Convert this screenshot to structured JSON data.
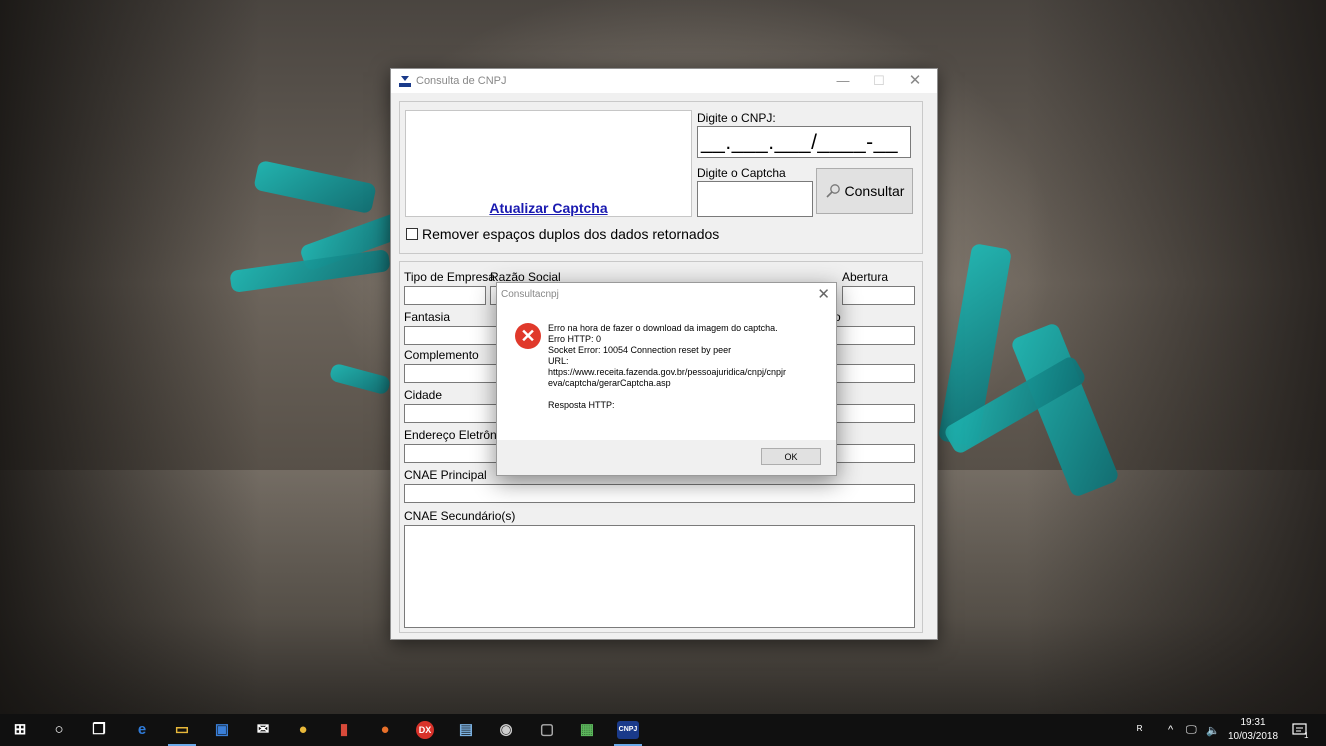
{
  "main_window": {
    "title": "Consulta de CNPJ",
    "minimize_glyph": "—",
    "maximize_glyph": "☐",
    "close_glyph": "✕",
    "captcha_link": "Atualizar Captcha",
    "cnpj_label": "Digite o CNPJ:",
    "cnpj_value": "__.___.___/____-__",
    "captcha_label": "Digite o Captcha",
    "consultar_button": "Consultar",
    "remove_spaces_checkbox": "Remover espaços duplos dos dados retornados",
    "remove_spaces_checked": false,
    "fields": {
      "tipo_empresa": "Tipo de Empresa",
      "razao_social": "Razão Social",
      "abertura": "Abertura",
      "fantasia": "Fantasia",
      "fantasia_right": "o",
      "complemento": "Complemento",
      "cidade": "Cidade",
      "email": "Endereço Eletrônic",
      "cnae_principal": "CNAE Principal",
      "cnae_secundarios": "CNAE Secundário(s)"
    }
  },
  "dialog": {
    "title": "Consultacnpj",
    "close_glyph": "✕",
    "error_glyph": "✕",
    "lines": [
      "Erro na hora de fazer o download da imagem do captcha.",
      "Erro HTTP: 0",
      "Socket Error: 10054 Connection reset by peer",
      "URL:",
      "https://www.receita.fazenda.gov.br/pessoajuridica/cnpj/cnpjr",
      "eva/captcha/gerarCaptcha.asp",
      "",
      "Resposta HTTP:"
    ],
    "ok_button": "OK"
  },
  "taskbar": {
    "apps": [
      {
        "name": "start",
        "glyph": "⊞",
        "color": "#ffffff"
      },
      {
        "name": "search",
        "glyph": "○",
        "color": "#ffffff"
      },
      {
        "name": "task-view",
        "glyph": "❐",
        "color": "#ffffff"
      },
      {
        "name": "edge",
        "glyph": "e",
        "color": "#2f7bd8"
      },
      {
        "name": "file-explorer",
        "glyph": "▭",
        "color": "#e8b83a"
      },
      {
        "name": "store",
        "glyph": "▣",
        "color": "#3a7fd8"
      },
      {
        "name": "mail",
        "glyph": "✉",
        "color": "#ffffff"
      },
      {
        "name": "chrome",
        "glyph": "●",
        "color": "#e8b83a"
      },
      {
        "name": "equalizer",
        "glyph": "▮",
        "color": "#d84a3a"
      },
      {
        "name": "firefox",
        "glyph": "●",
        "color": "#e8702a"
      },
      {
        "name": "dx",
        "glyph": "DX",
        "color": "#d8322a"
      },
      {
        "name": "notepad",
        "glyph": "▤",
        "color": "#7ab0e0"
      },
      {
        "name": "network-tool",
        "glyph": "◉",
        "color": "#cccccc"
      },
      {
        "name": "window-app",
        "glyph": "▢",
        "color": "#aaaaaa"
      },
      {
        "name": "notes",
        "glyph": "▦",
        "color": "#5cb85c"
      },
      {
        "name": "cnpj-app",
        "glyph": "CNPJ",
        "color": "#ffffff"
      }
    ],
    "tray_people": "ᴿ",
    "tray_chevron": "^",
    "tray_network": "🖵",
    "tray_volume": "🔈",
    "time": "19:31",
    "date": "10/03/2018",
    "notifications": "1"
  }
}
